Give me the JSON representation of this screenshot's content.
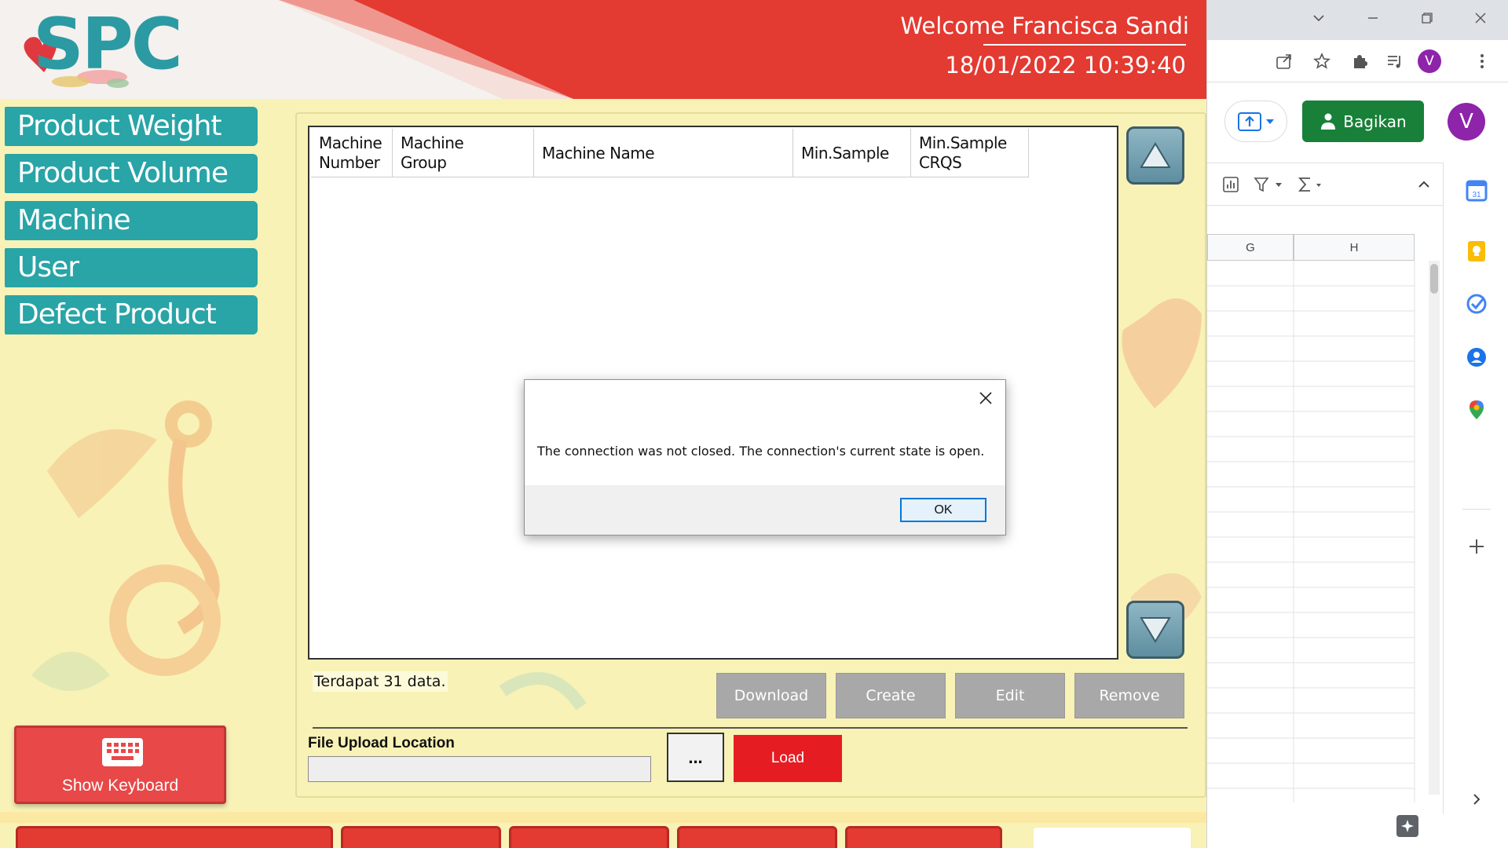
{
  "app": {
    "logo_text": "SPC",
    "welcome": "Welcome Francisca Sandi",
    "datetime": "18/01/2022 10:39:40",
    "sidebar": [
      {
        "label": "Product Weight"
      },
      {
        "label": "Product Volume"
      },
      {
        "label": "Machine"
      },
      {
        "label": "User"
      },
      {
        "label": "Defect Product"
      }
    ],
    "grid": {
      "columns": [
        {
          "line1": "Machine",
          "line2": "Number"
        },
        {
          "line1": "Machine",
          "line2": "Group"
        },
        {
          "line1": "Machine Name",
          "line2": ""
        },
        {
          "line1": "Min.Sample",
          "line2": ""
        },
        {
          "line1": "Min.Sample",
          "line2": "CRQS"
        }
      ]
    },
    "status": "Terdapat 31 data.",
    "actions": {
      "download": "Download",
      "create": "Create",
      "edit": "Edit",
      "remove": "Remove"
    },
    "upload": {
      "label": "File Upload Location",
      "value": "",
      "browse": "...",
      "load": "Load"
    },
    "keyboard": {
      "label": "Show Keyboard"
    },
    "colors": {
      "header": "#e33a31",
      "sidebar": "#29a4a7",
      "background": "#f8f2b6",
      "load": "#e61c23"
    }
  },
  "dialog": {
    "message": "The connection was not closed. The connection's current state is open.",
    "ok": "OK"
  },
  "browser": {
    "profile_initial": "V",
    "share_label": "Bagikan",
    "columns": [
      "G",
      "H"
    ],
    "accent": "#188038"
  }
}
